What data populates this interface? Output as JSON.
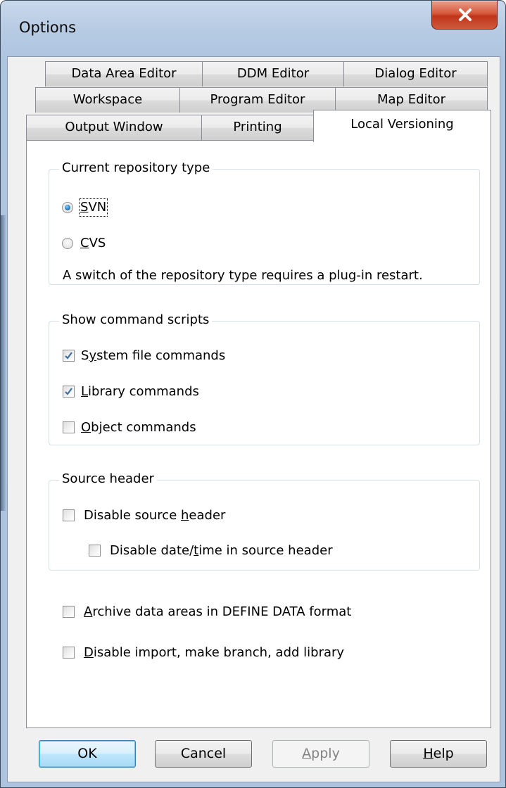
{
  "window": {
    "title": "Options"
  },
  "tabs": {
    "row1": [
      "Data Area Editor",
      "DDM Editor",
      "Dialog Editor"
    ],
    "row2": [
      "Workspace",
      "Program Editor",
      "Map Editor"
    ],
    "row3": [
      "Output Window",
      "Printing",
      "Local Versioning"
    ],
    "active": "Local Versioning"
  },
  "repository": {
    "group_label": "Current repository type",
    "options": [
      {
        "first": "S",
        "rest": "VN",
        "selected": true
      },
      {
        "first": "C",
        "rest": "VS",
        "selected": false
      }
    ],
    "note": "A switch of the repository type requires a plug-in restart."
  },
  "scripts": {
    "group_label": "Show command scripts",
    "items": [
      {
        "pre": "S",
        "ul": "y",
        "post": "stem file commands",
        "checked": true
      },
      {
        "pre": "",
        "ul": "L",
        "post": "ibrary commands",
        "checked": true
      },
      {
        "pre": "",
        "ul": "O",
        "post": "bject commands",
        "checked": false
      }
    ]
  },
  "source_header": {
    "group_label": "Source header",
    "disable_header": {
      "pre": "Disable source ",
      "ul": "h",
      "post": "eader",
      "checked": false
    },
    "disable_datetime": {
      "pre": "Disable date/",
      "ul": "t",
      "post": "ime in source header",
      "checked": false
    }
  },
  "archive": {
    "pre": "",
    "ul": "A",
    "post": "rchive data areas in DEFINE DATA format",
    "checked": false
  },
  "disable_import": {
    "pre": "",
    "ul": "D",
    "post": "isable import, make branch, add library",
    "checked": false
  },
  "buttons": {
    "ok": "OK",
    "cancel": "Cancel",
    "apply_ul": "A",
    "apply_rest": "pply",
    "help_ul": "H",
    "help_rest": "elp"
  },
  "colors": {
    "accent": "#2a7fc1",
    "close_button": "#c0351a",
    "frame": "#aec5e0"
  }
}
